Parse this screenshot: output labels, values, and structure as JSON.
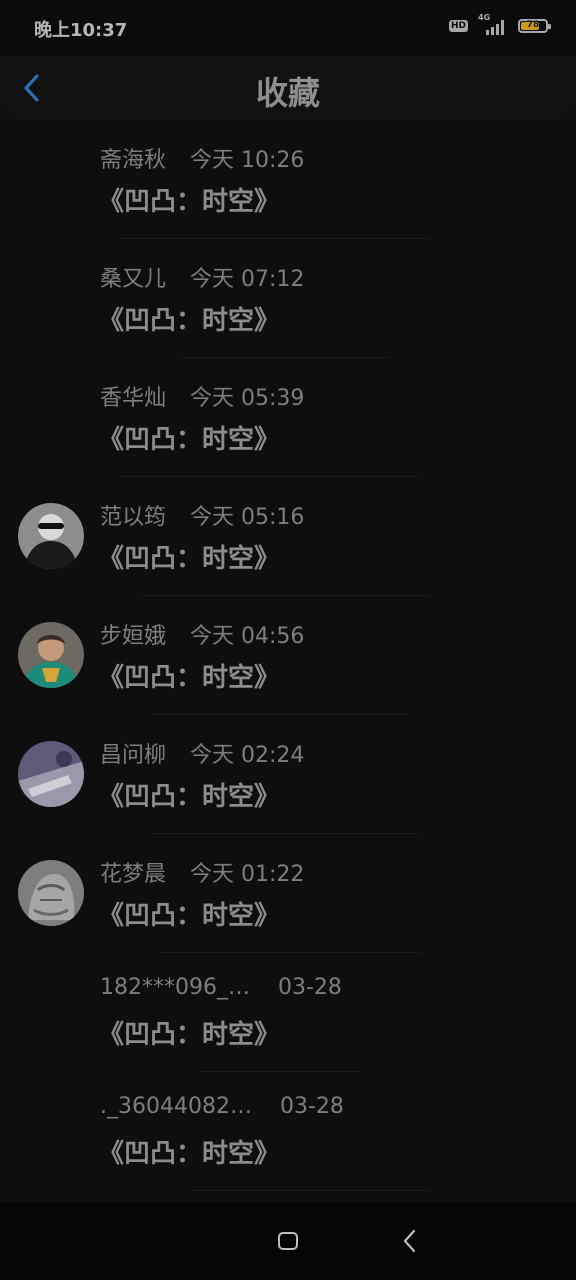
{
  "status_bar": {
    "time": "晚上10:37",
    "hd": "HD",
    "network": "4G",
    "battery": "78",
    "battery_level": 0.78
  },
  "header": {
    "title": "收藏",
    "back_icon": "chevron-left-icon"
  },
  "items": [
    {
      "name": "斋海秋",
      "time": "今天 10:26",
      "title": "《凹凸：时空》",
      "has_avatar": false
    },
    {
      "name": "桑又儿",
      "time": "今天 07:12",
      "title": "《凹凸：时空》",
      "has_avatar": false
    },
    {
      "name": "香华灿",
      "time": "今天 05:39",
      "title": "《凹凸：时空》",
      "has_avatar": false
    },
    {
      "name": "范以筠",
      "time": "今天 05:16",
      "title": "《凹凸：时空》",
      "has_avatar": true
    },
    {
      "name": "步姮娥",
      "time": "今天 04:56",
      "title": "《凹凸：时空》",
      "has_avatar": true
    },
    {
      "name": "昌问柳",
      "time": "今天 02:24",
      "title": "《凹凸：时空》",
      "has_avatar": true
    },
    {
      "name": "花梦晨",
      "time": "今天 01:22",
      "title": "《凹凸：时空》",
      "has_avatar": true
    },
    {
      "name": "182***096_…",
      "time": "03-28",
      "title": "《凹凸：时空》",
      "has_avatar": false
    },
    {
      "name": "._36044082…",
      "time": "03-28",
      "title": "《凹凸：时空》",
      "has_avatar": false
    }
  ],
  "nav": {
    "home_icon": "square-home-icon",
    "back_icon": "triangle-back-icon"
  },
  "colors": {
    "background": "#0e0e0e",
    "accent": "#2f6fb0",
    "battery": "#c99a1b"
  }
}
